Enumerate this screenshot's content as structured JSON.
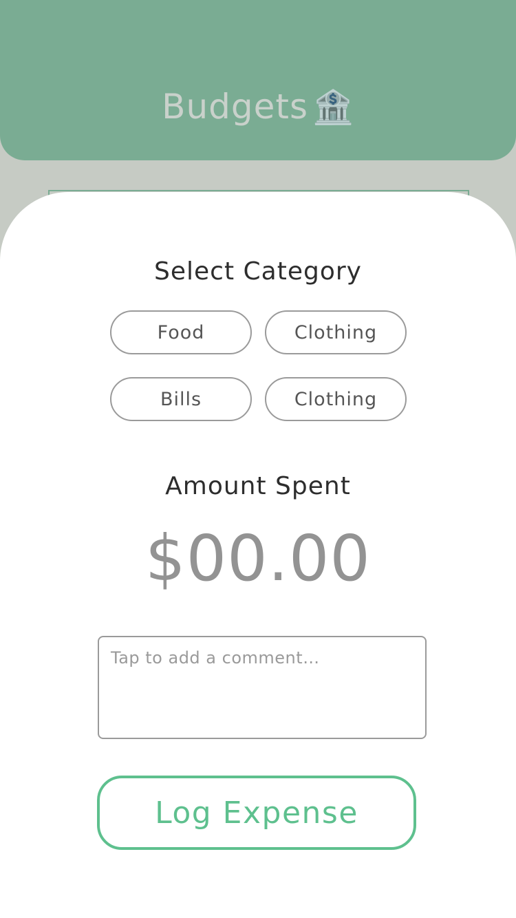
{
  "header": {
    "title": "Budgets",
    "title_icon": "🏦",
    "background_color": "#7aac93"
  },
  "category_section": {
    "title": "Select Category",
    "categories": [
      {
        "label": "Food"
      },
      {
        "label": "Clothing"
      },
      {
        "label": "Bills"
      },
      {
        "label": "Clothing"
      }
    ]
  },
  "amount_section": {
    "title": "Amount Spent",
    "value": "$00.00"
  },
  "comment": {
    "placeholder": "Tap to add a comment…",
    "value": ""
  },
  "log_button": {
    "label": "Log Expense",
    "accent_color": "#5ec08e"
  }
}
